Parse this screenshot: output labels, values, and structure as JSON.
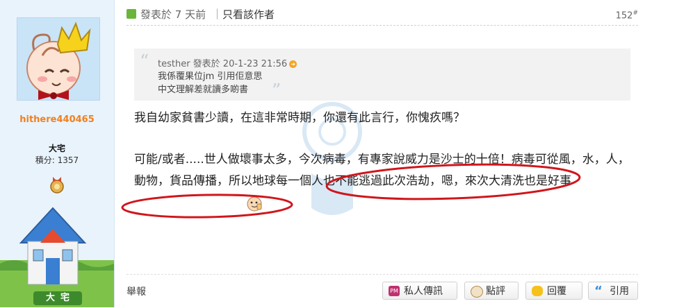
{
  "user": {
    "username": "hithere440465",
    "rank": "大宅",
    "points": "積分: 1357",
    "house_label": "大宅"
  },
  "post": {
    "posted_time": "發表於 7 天前",
    "separator": "|",
    "author_only_label": "只看該作者",
    "floor_number": "152",
    "floor_mark": "#",
    "quote": {
      "author_meta": "testher 發表於 20-1-23 21:56",
      "line1": "我係覆果位jm 引用佢意思",
      "line2": "中文理解差就讀多啲書"
    },
    "paragraph1": "我自幼家貧書少讀，在這非常時期，你還有此言行，你愧疚嗎？",
    "paragraph2": "可能/或者.....世人做壞事太多，今次病毒，有專家說威力是沙士的十倍！病毒可從風，水，人，動物，貨品傳播，所以地球每一個人也不能逃過此次浩劫，嗯，來次大清洗也是好事"
  },
  "footer": {
    "report_label": "舉報",
    "pm_label": "私人傳訊",
    "rate_label": "點評",
    "reply_label": "回覆",
    "quote_label": "引用"
  },
  "colors": {
    "username": "#f0801f",
    "annotation": "#d0161b",
    "sidebar_bg": "#e9f3fc"
  },
  "icons": [
    "post-icon",
    "pm-icon",
    "rate-icon",
    "reply-icon",
    "quote-icon",
    "quote-arrow-icon"
  ]
}
